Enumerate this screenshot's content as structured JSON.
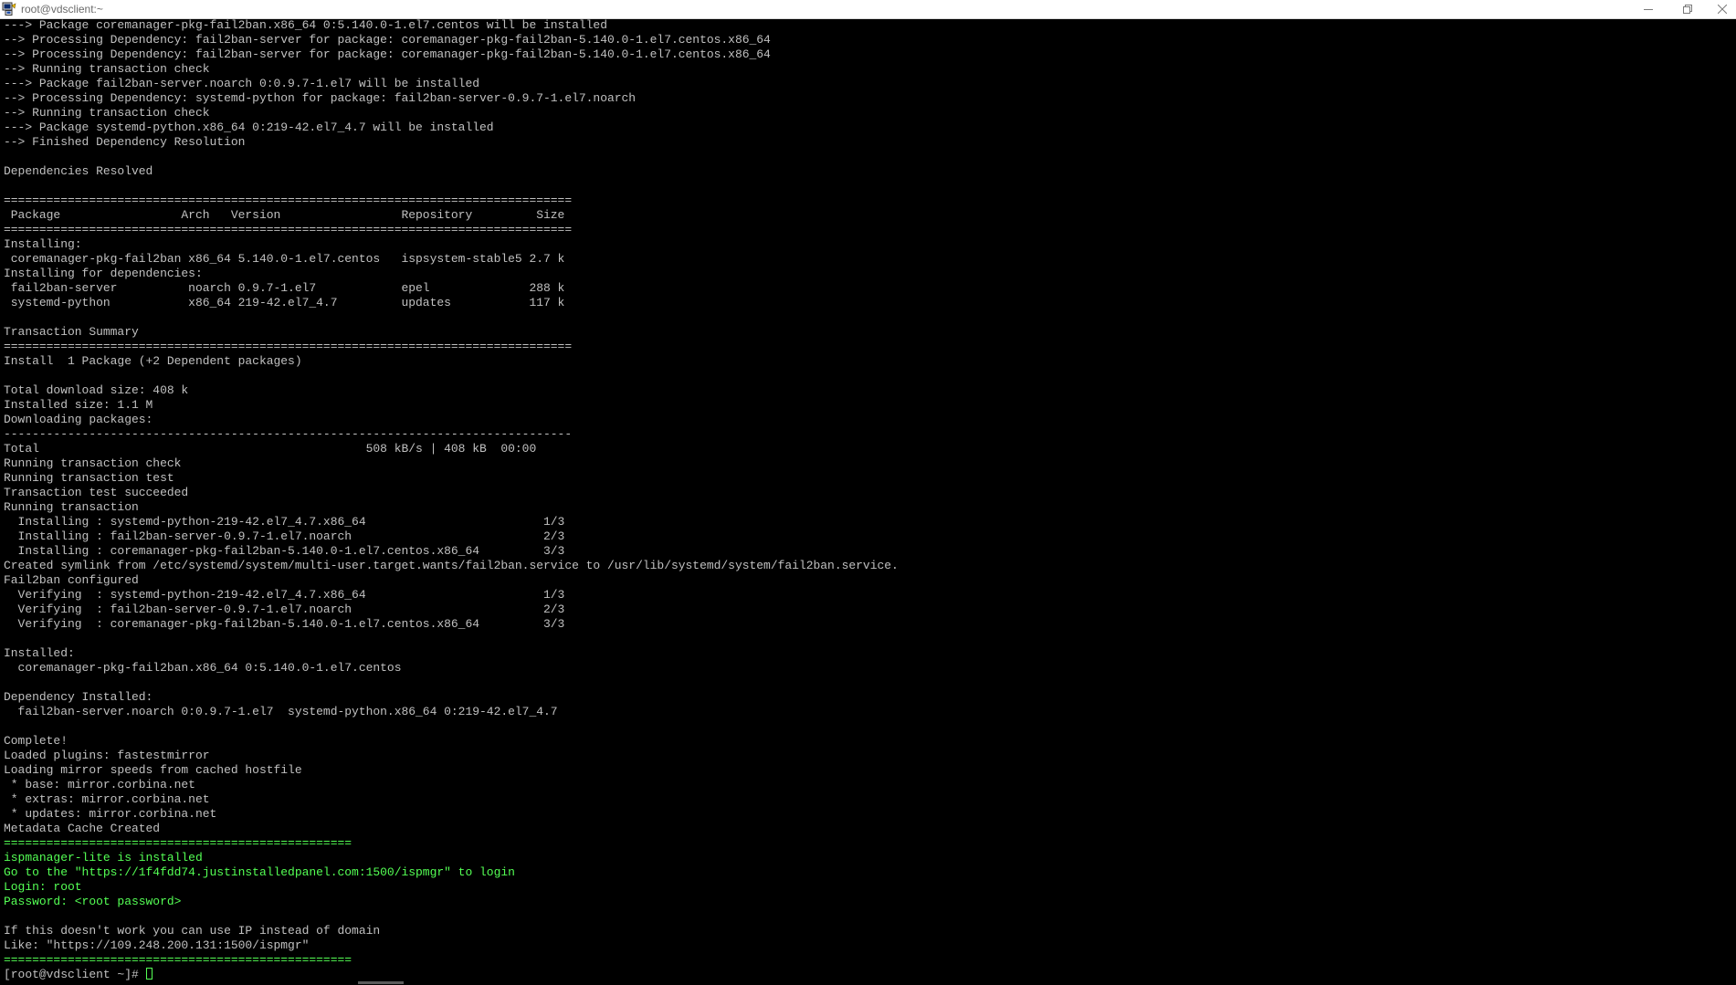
{
  "window": {
    "title": "root@vdsclient:~",
    "icon": "putty-terminal-icon",
    "controls": [
      "minimize",
      "maximize",
      "close"
    ]
  },
  "colors": {
    "background": "#000000",
    "text": "#c0c0c0",
    "highlight": "#54ff54"
  },
  "terminal": {
    "lines": [
      {
        "text": "---> Package coremanager-pkg-fail2ban.x86_64 0:5.140.0-1.el7.centos will be installed",
        "green": false
      },
      {
        "text": "--> Processing Dependency: fail2ban-server for package: coremanager-pkg-fail2ban-5.140.0-1.el7.centos.x86_64",
        "green": false
      },
      {
        "text": "--> Processing Dependency: fail2ban-server for package: coremanager-pkg-fail2ban-5.140.0-1.el7.centos.x86_64",
        "green": false
      },
      {
        "text": "--> Running transaction check",
        "green": false
      },
      {
        "text": "---> Package fail2ban-server.noarch 0:0.9.7-1.el7 will be installed",
        "green": false
      },
      {
        "text": "--> Processing Dependency: systemd-python for package: fail2ban-server-0.9.7-1.el7.noarch",
        "green": false
      },
      {
        "text": "--> Running transaction check",
        "green": false
      },
      {
        "text": "---> Package systemd-python.x86_64 0:219-42.el7_4.7 will be installed",
        "green": false
      },
      {
        "text": "--> Finished Dependency Resolution",
        "green": false
      },
      {
        "text": "",
        "green": false
      },
      {
        "text": "Dependencies Resolved",
        "green": false
      },
      {
        "text": "",
        "green": false
      },
      {
        "text": "================================================================================",
        "green": false
      },
      {
        "text": " Package                 Arch   Version                 Repository         Size",
        "green": false
      },
      {
        "text": "================================================================================",
        "green": false
      },
      {
        "text": "Installing:",
        "green": false
      },
      {
        "text": " coremanager-pkg-fail2ban x86_64 5.140.0-1.el7.centos   ispsystem-stable5 2.7 k",
        "green": false
      },
      {
        "text": "Installing for dependencies:",
        "green": false
      },
      {
        "text": " fail2ban-server          noarch 0.9.7-1.el7            epel              288 k",
        "green": false
      },
      {
        "text": " systemd-python           x86_64 219-42.el7_4.7         updates           117 k",
        "green": false
      },
      {
        "text": "",
        "green": false
      },
      {
        "text": "Transaction Summary",
        "green": false
      },
      {
        "text": "================================================================================",
        "green": false
      },
      {
        "text": "Install  1 Package (+2 Dependent packages)",
        "green": false
      },
      {
        "text": "",
        "green": false
      },
      {
        "text": "Total download size: 408 k",
        "green": false
      },
      {
        "text": "Installed size: 1.1 M",
        "green": false
      },
      {
        "text": "Downloading packages:",
        "green": false
      },
      {
        "text": "--------------------------------------------------------------------------------",
        "green": false
      },
      {
        "text": "Total                                              508 kB/s | 408 kB  00:00",
        "green": false
      },
      {
        "text": "Running transaction check",
        "green": false
      },
      {
        "text": "Running transaction test",
        "green": false
      },
      {
        "text": "Transaction test succeeded",
        "green": false
      },
      {
        "text": "Running transaction",
        "green": false
      },
      {
        "text": "  Installing : systemd-python-219-42.el7_4.7.x86_64                         1/3",
        "green": false
      },
      {
        "text": "  Installing : fail2ban-server-0.9.7-1.el7.noarch                           2/3",
        "green": false
      },
      {
        "text": "  Installing : coremanager-pkg-fail2ban-5.140.0-1.el7.centos.x86_64         3/3",
        "green": false
      },
      {
        "text": "Created symlink from /etc/systemd/system/multi-user.target.wants/fail2ban.service to /usr/lib/systemd/system/fail2ban.service.",
        "green": false
      },
      {
        "text": "Fail2ban configured",
        "green": false
      },
      {
        "text": "  Verifying  : systemd-python-219-42.el7_4.7.x86_64                         1/3",
        "green": false
      },
      {
        "text": "  Verifying  : fail2ban-server-0.9.7-1.el7.noarch                           2/3",
        "green": false
      },
      {
        "text": "  Verifying  : coremanager-pkg-fail2ban-5.140.0-1.el7.centos.x86_64         3/3",
        "green": false
      },
      {
        "text": "",
        "green": false
      },
      {
        "text": "Installed:",
        "green": false
      },
      {
        "text": "  coremanager-pkg-fail2ban.x86_64 0:5.140.0-1.el7.centos",
        "green": false
      },
      {
        "text": "",
        "green": false
      },
      {
        "text": "Dependency Installed:",
        "green": false
      },
      {
        "text": "  fail2ban-server.noarch 0:0.9.7-1.el7  systemd-python.x86_64 0:219-42.el7_4.7",
        "green": false
      },
      {
        "text": "",
        "green": false
      },
      {
        "text": "Complete!",
        "green": false
      },
      {
        "text": "Loaded plugins: fastestmirror",
        "green": false
      },
      {
        "text": "Loading mirror speeds from cached hostfile",
        "green": false
      },
      {
        "text": " * base: mirror.corbina.net",
        "green": false
      },
      {
        "text": " * extras: mirror.corbina.net",
        "green": false
      },
      {
        "text": " * updates: mirror.corbina.net",
        "green": false
      },
      {
        "text": "Metadata Cache Created",
        "green": false
      },
      {
        "text": "=================================================",
        "green": true
      },
      {
        "text": "ispmanager-lite is installed",
        "green": true
      },
      {
        "text": "Go to the \"https://1f4fdd74.justinstalledpanel.com:1500/ispmgr\" to login",
        "green": true
      },
      {
        "text": "Login: root",
        "green": true
      },
      {
        "text": "Password: <root password>",
        "green": true
      },
      {
        "text": "",
        "green": false
      },
      {
        "text": "If this doesn't work you can use IP instead of domain",
        "green": false
      },
      {
        "text": "Like: \"https://109.248.200.131:1500/ispmgr\"",
        "green": false
      },
      {
        "text": "=================================================",
        "green": true
      }
    ],
    "prompt": "[root@vdsclient ~]# "
  }
}
